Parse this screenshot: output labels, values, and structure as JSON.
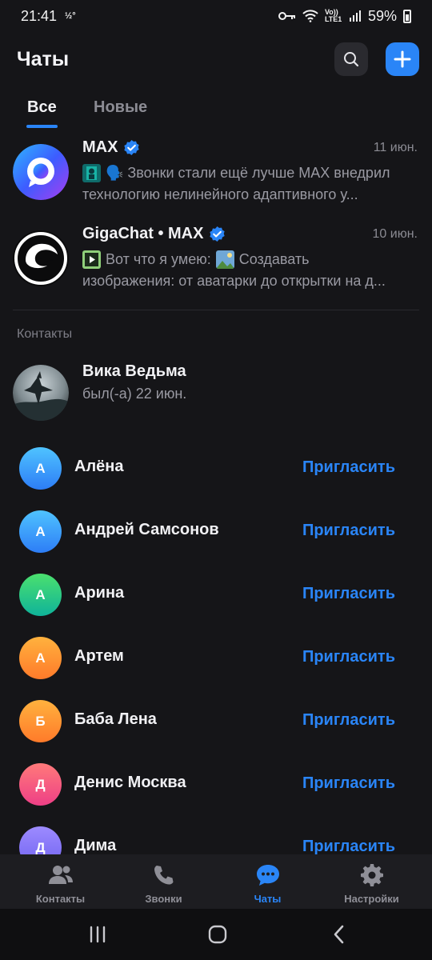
{
  "status_bar": {
    "time": "21:41",
    "left_indicator": "½°",
    "lte_label": "Vo)) LTE1",
    "battery": "59%"
  },
  "header": {
    "title": "Чаты"
  },
  "tabs": [
    {
      "label": "Все"
    },
    {
      "label": "Новые"
    }
  ],
  "chats": [
    {
      "name": "MAX",
      "date": "11 июн.",
      "preview_line1": "🗣️ Звонки стали ещё лучше MAX внедрил",
      "preview_line2": "технологию нелинейного адаптивного у..."
    },
    {
      "name": "GigaChat • MAX",
      "date": "10 июн.",
      "preview_line1a": "Вот что я умею:",
      "preview_line1b": "Создавать",
      "preview_line2": "изображения: от аватарки до открытки на д..."
    }
  ],
  "contacts_section": {
    "label": "Контакты"
  },
  "featured_contact": {
    "name": "Вика Ведьма",
    "status": "был(-а) 22 июн."
  },
  "contacts": [
    {
      "initial": "А",
      "name": "Алёна",
      "invite": "Пригласить",
      "color_top": "#4fc3ff",
      "color_bottom": "#2d7df6"
    },
    {
      "initial": "А",
      "name": "Андрей Самсонов",
      "invite": "Пригласить",
      "color_top": "#4fc3ff",
      "color_bottom": "#2d7df6"
    },
    {
      "initial": "А",
      "name": "Арина",
      "invite": "Пригласить",
      "color_top": "#4be06e",
      "color_bottom": "#0fb39a"
    },
    {
      "initial": "А",
      "name": "Артем",
      "invite": "Пригласить",
      "color_top": "#ffb23e",
      "color_bottom": "#ff7a2a"
    },
    {
      "initial": "Б",
      "name": "Баба Лена",
      "invite": "Пригласить",
      "color_top": "#ffb23e",
      "color_bottom": "#ff7a2a"
    },
    {
      "initial": "Д",
      "name": "Денис Москва",
      "invite": "Пригласить",
      "color_top": "#ff7a7a",
      "color_bottom": "#ee3f86"
    },
    {
      "initial": "Д",
      "name": "Дима",
      "invite": "Пригласить",
      "color_top": "#9d8bff",
      "color_bottom": "#6f62f0"
    }
  ],
  "bottom_tabs": [
    {
      "label": "Контакты",
      "icon": "contacts-icon"
    },
    {
      "label": "Звонки",
      "icon": "phone-icon"
    },
    {
      "label": "Чаты",
      "icon": "chat-icon",
      "active": true
    },
    {
      "label": "Настройки",
      "icon": "gear-icon"
    }
  ],
  "colors": {
    "accent": "#2a85f7",
    "background": "#151518"
  }
}
